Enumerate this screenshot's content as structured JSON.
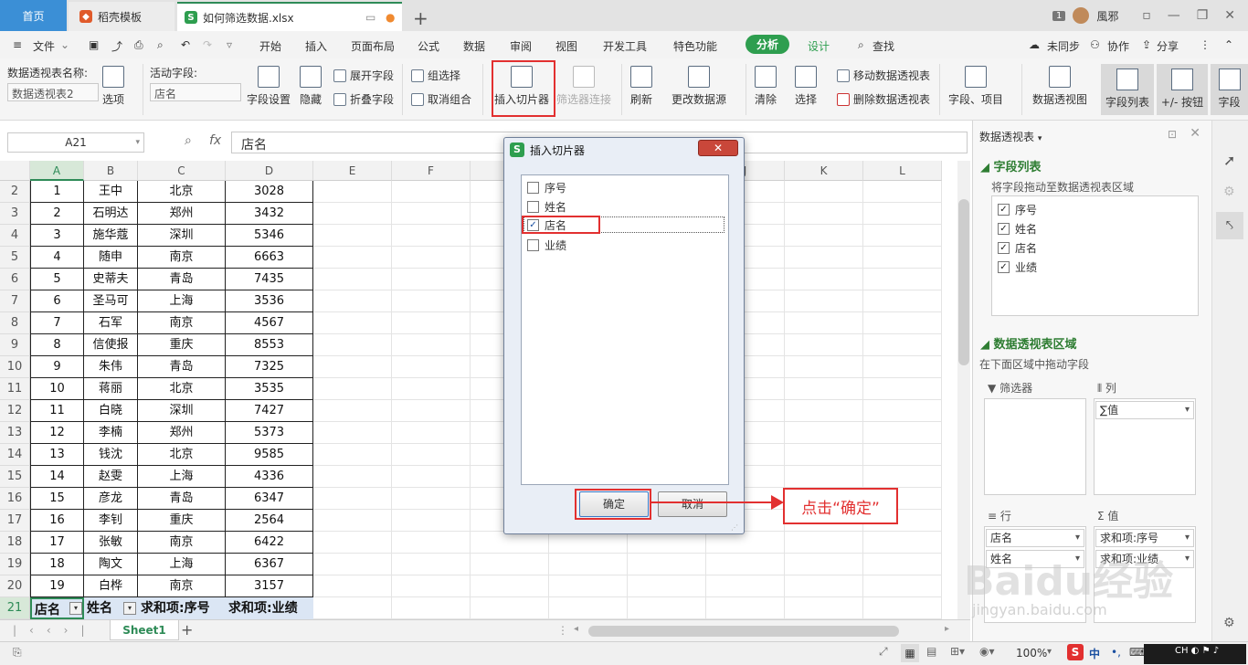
{
  "titlebar": {
    "tabs": [
      "首页",
      "稻壳模板",
      "如何筛选数据.xlsx"
    ],
    "add": "+",
    "badge": "1",
    "user": "風邪"
  },
  "menu": {
    "file": "文件",
    "items": [
      "开始",
      "插入",
      "页面布局",
      "公式",
      "数据",
      "审阅",
      "视图",
      "开发工具",
      "特色功能",
      "分析",
      "设计"
    ],
    "search": "查找",
    "sync": "未同步",
    "collab": "协作",
    "share": "分享"
  },
  "ribbon": {
    "pivot_name_label": "数据透视表名称:",
    "pivot_name_value": "数据透视表2",
    "options": "选项",
    "active_field_label": "活动字段:",
    "active_field_value": "店名",
    "field_settings": "字段设置",
    "hide": "隐藏",
    "expand_field": "展开字段",
    "collapse_field": "折叠字段",
    "group_selection": "组选择",
    "ungroup": "取消组合",
    "insert_slicer": "插入切片器",
    "filter_connections": "筛选器连接",
    "refresh": "刷新",
    "change_source": "更改数据源",
    "clear": "清除",
    "select": "选择",
    "move_pivot": "移动数据透视表",
    "delete_pivot": "删除数据透视表",
    "fields_items": "字段、项目",
    "pivot_chart": "数据透视图",
    "field_list": "字段列表",
    "plus_minus": "+/- 按钮",
    "field_headers": "字段"
  },
  "formula": {
    "cell_ref": "A21",
    "fx": "fx",
    "content": "店名"
  },
  "grid": {
    "columns": [
      "A",
      "B",
      "C",
      "D",
      "E",
      "F",
      "G",
      "H",
      "I",
      "J",
      "K",
      "L"
    ],
    "rows": [
      {
        "n": "2",
        "a": "1",
        "b": "王中",
        "c": "北京",
        "d": "3028"
      },
      {
        "n": "3",
        "a": "2",
        "b": "石明达",
        "c": "郑州",
        "d": "3432"
      },
      {
        "n": "4",
        "a": "3",
        "b": "施华蔻",
        "c": "深圳",
        "d": "5346"
      },
      {
        "n": "5",
        "a": "4",
        "b": "随申",
        "c": "南京",
        "d": "6663"
      },
      {
        "n": "6",
        "a": "5",
        "b": "史蒂夫",
        "c": "青岛",
        "d": "7435"
      },
      {
        "n": "7",
        "a": "6",
        "b": "圣马可",
        "c": "上海",
        "d": "3536"
      },
      {
        "n": "8",
        "a": "7",
        "b": "石军",
        "c": "南京",
        "d": "4567"
      },
      {
        "n": "9",
        "a": "8",
        "b": "信使报",
        "c": "重庆",
        "d": "8553"
      },
      {
        "n": "10",
        "a": "9",
        "b": "朱伟",
        "c": "青岛",
        "d": "7325"
      },
      {
        "n": "11",
        "a": "10",
        "b": "蒋丽",
        "c": "北京",
        "d": "3535"
      },
      {
        "n": "12",
        "a": "11",
        "b": "白晓",
        "c": "深圳",
        "d": "7427"
      },
      {
        "n": "13",
        "a": "12",
        "b": "李楠",
        "c": "郑州",
        "d": "5373"
      },
      {
        "n": "14",
        "a": "13",
        "b": "钱沈",
        "c": "北京",
        "d": "9585"
      },
      {
        "n": "15",
        "a": "14",
        "b": "赵雯",
        "c": "上海",
        "d": "4336"
      },
      {
        "n": "16",
        "a": "15",
        "b": "彦龙",
        "c": "青岛",
        "d": "6347"
      },
      {
        "n": "17",
        "a": "16",
        "b": "李钊",
        "c": "重庆",
        "d": "2564"
      },
      {
        "n": "18",
        "a": "17",
        "b": "张敏",
        "c": "南京",
        "d": "6422"
      },
      {
        "n": "19",
        "a": "18",
        "b": "陶文",
        "c": "上海",
        "d": "6367"
      },
      {
        "n": "20",
        "a": "19",
        "b": "白桦",
        "c": "南京",
        "d": "3157"
      }
    ],
    "pivot_row": {
      "n": "21",
      "a": "店名",
      "b": "姓名",
      "c": "求和项:序号",
      "d": "求和项:业绩"
    }
  },
  "sheet": {
    "tab": "Sheet1",
    "add": "+"
  },
  "status": {
    "zoom": "100%",
    "ime": "中"
  },
  "panel": {
    "title": "数据透视表",
    "field_list_title": "字段列表",
    "field_list_hint": "将字段拖动至数据透视表区域",
    "fields": [
      "序号",
      "姓名",
      "店名",
      "业绩"
    ],
    "area_title": "数据透视表区域",
    "area_hint": "在下面区域中拖动字段",
    "filter_label": "筛选器",
    "col_label": "列",
    "row_label": "行",
    "val_label": "值",
    "col_items": [
      "∑值"
    ],
    "row_items": [
      "店名",
      "姓名"
    ],
    "val_items": [
      "求和项:序号",
      "求和项:业绩"
    ]
  },
  "dialog": {
    "title": "插入切片器",
    "items": [
      {
        "label": "序号",
        "checked": false
      },
      {
        "label": "姓名",
        "checked": false
      },
      {
        "label": "店名",
        "checked": true
      },
      {
        "label": "业绩",
        "checked": false
      }
    ],
    "ok": "确定",
    "cancel": "取消"
  },
  "annotation": {
    "callout": "点击“确定”"
  },
  "watermark": {
    "brand": "Baidu经验",
    "url": "jingyan.baidu.com"
  },
  "colors": {
    "accent": "#2e9e4f",
    "annotation": "#e23030",
    "home_tab": "#3b8fd6"
  }
}
